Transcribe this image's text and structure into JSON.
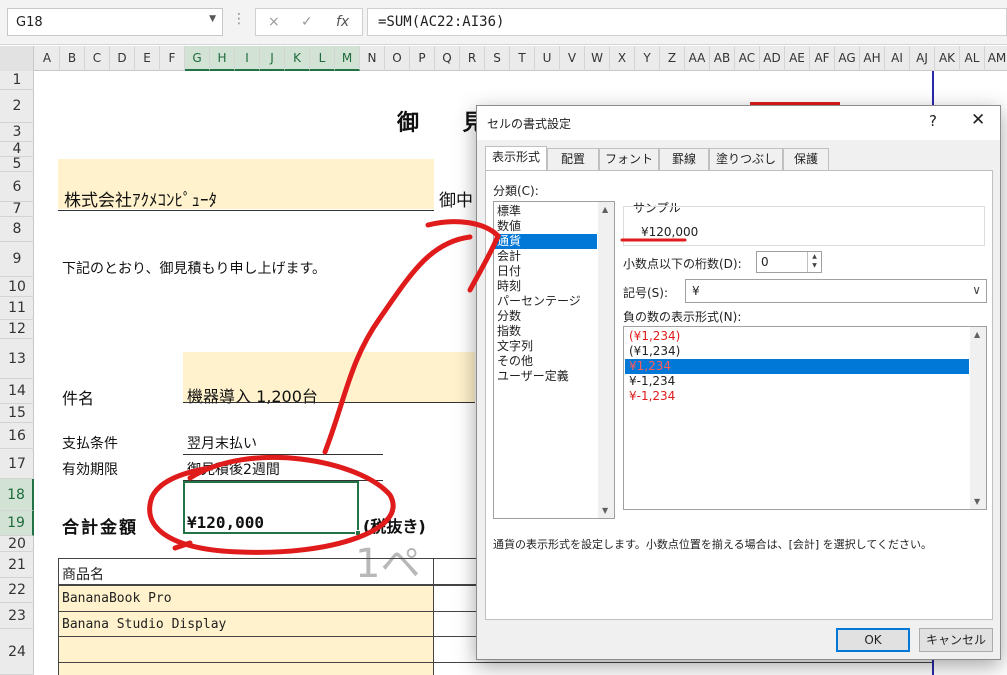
{
  "formula_bar": {
    "name_box": "G18",
    "cancel_icon": "×",
    "enter_icon": "✓",
    "fx_icon": "fx",
    "formula": "=SUM(AC22:AI36)"
  },
  "columns": [
    "A",
    "B",
    "C",
    "D",
    "E",
    "F",
    "G",
    "H",
    "I",
    "J",
    "K",
    "L",
    "M",
    "N",
    "O",
    "P",
    "Q",
    "R",
    "S",
    "T",
    "U",
    "V",
    "W",
    "X",
    "Y",
    "Z",
    "AA",
    "AB",
    "AC",
    "AD",
    "AE",
    "AF",
    "AG",
    "AH",
    "AI",
    "AJ",
    "AK",
    "AL",
    "AM"
  ],
  "selected_columns": [
    "G",
    "H",
    "I",
    "J",
    "K",
    "L",
    "M"
  ],
  "rows": [
    "1",
    "2",
    "3",
    "4",
    "5",
    "6",
    "7",
    "8",
    "9",
    "10",
    "11",
    "12",
    "13",
    "14",
    "15",
    "16",
    "17",
    "18",
    "19",
    "20",
    "21",
    "22",
    "23",
    "24"
  ],
  "selected_rows": [
    "18",
    "19"
  ],
  "sheet": {
    "title": "御 見",
    "customer": "株式会社ｱｸﾒｺﾝﾋﾟｭｰﾀ",
    "onchu": "御中",
    "greeting": "下記のとおり、御見積もり申し上げます。",
    "subject_label": "件名",
    "subject_value": "機器導入 1,200台",
    "payment_label": "支払条件",
    "payment_value": "翌月末払い",
    "validity_label": "有効期限",
    "validity_value": "御見積後2週間",
    "total_label": "合計金額",
    "total_value": "¥120,000",
    "tax_note": "(税抜き)",
    "watermark": "1ペ",
    "table_header": "商品名",
    "items": [
      "BananaBook Pro",
      "Banana Studio Display"
    ]
  },
  "dialog": {
    "title": "セルの書式設定",
    "help": "?",
    "close": "✕",
    "tabs": [
      "表示形式",
      "配置",
      "フォント",
      "罫線",
      "塗りつぶし",
      "保護"
    ],
    "active_tab": "表示形式",
    "category_label": "分類(C):",
    "categories": [
      "標準",
      "数値",
      "通貨",
      "会計",
      "日付",
      "時刻",
      "パーセンテージ",
      "分数",
      "指数",
      "文字列",
      "その他",
      "ユーザー定義"
    ],
    "selected_category": "通貨",
    "sample_label": "サンプル",
    "sample_value": "¥120,000",
    "decimal_label": "小数点以下の桁数(D):",
    "decimal_value": "0",
    "symbol_label": "記号(S):",
    "symbol_value": "¥",
    "negative_label": "負の数の表示形式(N):",
    "negative_formats": [
      "(¥1,234)",
      "(¥1,234)",
      "¥1,234",
      "¥-1,234",
      "¥-1,234"
    ],
    "negative_red_flags": [
      true,
      false,
      true,
      false,
      true
    ],
    "negative_selected_index": 2,
    "description": "通貨の表示形式を設定します。小数点位置を揃える場合は、[会計] を選択してください。",
    "ok": "OK",
    "cancel": "キャンセル"
  },
  "colors": {
    "accent_green": "#217346",
    "selection_blue": "#0078d7",
    "annotation_red": "#e01b1b",
    "cell_fill": "#fff2cc"
  }
}
